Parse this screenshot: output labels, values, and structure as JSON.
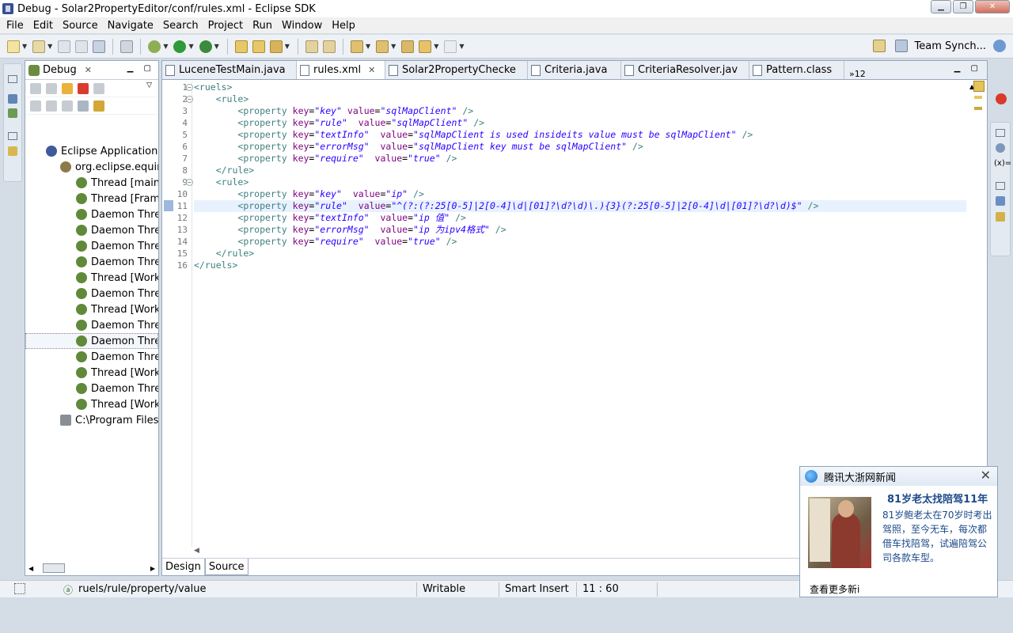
{
  "window": {
    "title": "Debug - Solar2PropertyEditor/conf/rules.xml - Eclipse SDK"
  },
  "menu": [
    "File",
    "Edit",
    "Source",
    "Navigate",
    "Search",
    "Project",
    "Run",
    "Window",
    "Help"
  ],
  "toolbar": {
    "team_label": "Team Synch..."
  },
  "debug_view": {
    "tab_label": "Debug",
    "tree": [
      "Eclipse Application [E",
      "org.eclipse.equin",
      "Thread [main]",
      "Thread [Frame",
      "Daemon Threa",
      "Daemon Threa",
      "Daemon Threa",
      "Daemon Threa",
      "Thread [Work",
      "Daemon Threa",
      "Thread [Work",
      "Daemon Threa",
      "Daemon Threa",
      "Daemon Threa",
      "Thread [Work",
      "Daemon Threa",
      "Thread [Work",
      "C:\\Program Files\\"
    ]
  },
  "editor": {
    "tabs": [
      "LuceneTestMain.java",
      "rules.xml",
      "Solar2PropertyChecke",
      "Criteria.java",
      "CriteriaResolver.jav",
      "Pattern.class"
    ],
    "overflow": "»12",
    "lines": [
      {
        "n": "1",
        "t": "<ruels>"
      },
      {
        "n": "2",
        "t": "    <rule>"
      },
      {
        "n": "3",
        "t": "        <property key=\"key\" value=\"sqlMapClient\" />"
      },
      {
        "n": "4",
        "t": "        <property key=\"rule\"  value=\"sqlMapClient\" />"
      },
      {
        "n": "5",
        "t": "        <property key=\"textInfo\"  value=\"sqlMapClient is used insideits value must be sqlMapClient\" />"
      },
      {
        "n": "6",
        "t": "        <property key=\"errorMsg\"  value=\"sqlMapClient key must be sqlMapClient\" />"
      },
      {
        "n": "7",
        "t": "        <property key=\"require\"  value=\"true\" />"
      },
      {
        "n": "8",
        "t": "    </rule>"
      },
      {
        "n": "9",
        "t": "    <rule>"
      },
      {
        "n": "10",
        "t": "        <property key=\"key\"  value=\"ip\" />"
      },
      {
        "n": "11",
        "t": "        <property key=\"rule\"  value=\"^(?:(?:25[0-5]|2[0-4]\\d|[01]?\\d?\\d)\\.){3}(?:25[0-5]|2[0-4]\\d|[01]?\\d?\\d)$\" />"
      },
      {
        "n": "12",
        "t": "        <property key=\"textInfo\"  value=\"ip 值\" />"
      },
      {
        "n": "13",
        "t": "        <property key=\"errorMsg\"  value=\"ip 为ipv4格式\" />"
      },
      {
        "n": "14",
        "t": "        <property key=\"require\"  value=\"true\" />"
      },
      {
        "n": "15",
        "t": "    </rule>"
      },
      {
        "n": "16",
        "t": "</ruels>"
      }
    ],
    "bottom_tabs": [
      "Design",
      "Source"
    ]
  },
  "status": {
    "path": "ruels/rule/property/value",
    "writable": "Writable",
    "mode": "Smart Insert",
    "position": "11 : 60"
  },
  "popup": {
    "source": "腾讯大浙网新闻",
    "headline": "81岁老太找陪驾11年",
    "body": "81岁鲍老太在70岁时考出驾照，至今无车，每次都借车找陪驾，试遍陪驾公司各款车型。",
    "more": "查看更多新i"
  }
}
